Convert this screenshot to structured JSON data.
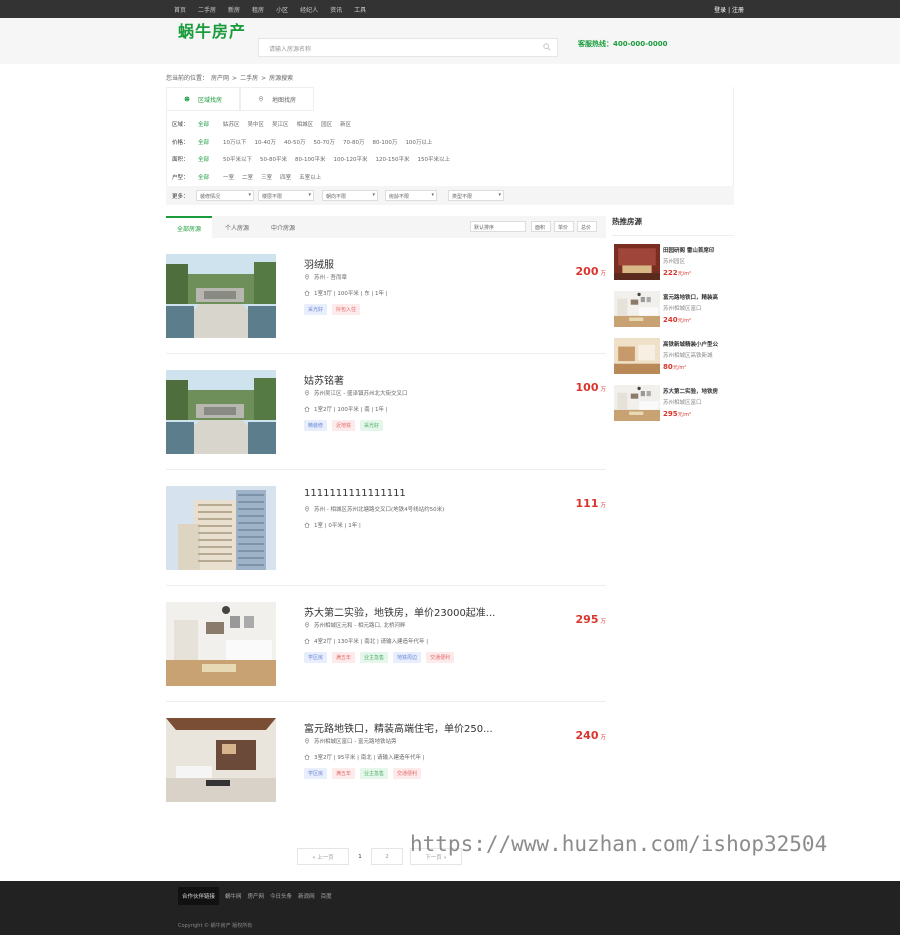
{
  "topbar": {
    "nav": [
      "首页",
      "二手房",
      "新房",
      "租房",
      "小区",
      "经纪人",
      "资讯",
      "工具"
    ],
    "login": "登录 | 注册"
  },
  "header": {
    "logo": "蜗牛房产",
    "search_placeholder": "请输入房源名称",
    "hotline": "客服热线：400-000-0000"
  },
  "breadcrumb": [
    "您当前的位置：",
    "房产网",
    ">",
    "二手房",
    ">",
    "房源搜索"
  ],
  "filter_tabs": [
    "区域找房",
    "地图找房"
  ],
  "filters": [
    {
      "label": "区域：",
      "options": [
        "全部",
        "姑苏区",
        "吴中区",
        "吴江区",
        "相城区",
        "园区",
        "新区"
      ]
    },
    {
      "label": "价格：",
      "options": [
        "全部",
        "10万以下",
        "10-40万",
        "40-50万",
        "50-70万",
        "70-80万",
        "80-100万",
        "100万以上"
      ]
    },
    {
      "label": "面积：",
      "options": [
        "全部",
        "50平米以下",
        "50-80平米",
        "80-100平米",
        "100-120平米",
        "120-150平米",
        "150平米以上"
      ]
    },
    {
      "label": "户型：",
      "options": [
        "全部",
        "一室",
        "二室",
        "三室",
        "四室",
        "五室以上"
      ]
    }
  ],
  "more": {
    "label": "更多：",
    "selects": [
      "装修情况",
      "楼层不限",
      "朝向不限",
      "房龄不限",
      "类型不限"
    ]
  },
  "list_tabs": [
    "全部房源",
    "个人房源",
    "中介房源"
  ],
  "sort": [
    "默认排序",
    "面积",
    "单价",
    "总价"
  ],
  "listings": [
    {
      "title": "羽绒服",
      "address": "苏州 - 吾而章",
      "info": "1室3厅 | 100平米 | 东 | 1年 |",
      "tags": [
        {
          "t": "采光好",
          "c": "blue"
        },
        {
          "t": "拎包入住",
          "c": "red"
        }
      ],
      "price": "200",
      "unit": "万",
      "pic": "garden"
    },
    {
      "title": "姑苏铭著",
      "address": "苏州吴江区 - 盛泽镇苏州北大街交叉口",
      "info": "1室2厅 | 100平米 | 南 | 1年 |",
      "tags": [
        {
          "t": "精装修",
          "c": "blue"
        },
        {
          "t": "近地铁",
          "c": "red"
        },
        {
          "t": "采光好",
          "c": "green"
        }
      ],
      "price": "100",
      "unit": "万",
      "pic": "garden"
    },
    {
      "title": "1111111111111111",
      "address": "苏州 - 相城区苏州北塘路交叉口(地铁4号线站约50米)",
      "info": "1室 | 0平米 | 1年 |",
      "tags": [],
      "price": "111",
      "unit": "万",
      "pic": "tower"
    },
    {
      "title": "苏大第二实验，地铁房，单价23000起准...",
      "address": "苏州相城区元和 - 相元路口, 北桥河畔",
      "info": "4室2厅 | 130平米 | 南北 | 请输入建造年代年 |",
      "tags": [
        {
          "t": "学区房",
          "c": "blue"
        },
        {
          "t": "满五年",
          "c": "red"
        },
        {
          "t": "业主急售",
          "c": "green"
        },
        {
          "t": "地铁周边",
          "c": "blue"
        },
        {
          "t": "交通便利",
          "c": "red"
        }
      ],
      "price": "295",
      "unit": "万",
      "pic": "living"
    },
    {
      "title": "富元路地铁口，精装高端住宅，单价250...",
      "address": "苏州相城区富口 - 富元路地铁站旁",
      "info": "3室2厅 | 95平米 | 南北 | 请输入建造年代年 |",
      "tags": [
        {
          "t": "学区房",
          "c": "blue"
        },
        {
          "t": "满五年",
          "c": "red"
        },
        {
          "t": "业主急售",
          "c": "green"
        },
        {
          "t": "交通便利",
          "c": "red"
        }
      ],
      "price": "240",
      "unit": "万",
      "pic": "lounge"
    }
  ],
  "hot": {
    "title": "热推房源",
    "items": [
      {
        "title": "田园研阁 雷山首席印",
        "addr": "苏州园区",
        "price": "222",
        "unit": "元/m²",
        "pic": "red"
      },
      {
        "title": "富元路地铁口，精装高",
        "addr": "苏州相城区富口",
        "price": "240",
        "unit": "元/m²",
        "pic": "living"
      },
      {
        "title": "高铁新城精装小户型公",
        "addr": "苏州相城区高铁新城",
        "price": "80",
        "unit": "元/m²",
        "pic": "warm"
      },
      {
        "title": "苏大第二实验，地铁房",
        "addr": "苏州相城区富口",
        "price": "295",
        "unit": "元/m²",
        "pic": "living"
      }
    ]
  },
  "pager": {
    "prev": "« 上一页",
    "current": "1",
    "page2": "2",
    "next": "下一页 »"
  },
  "watermark": "https://www.huzhan.com/ishop32504",
  "footer": {
    "links_title": "合作伙伴链接",
    "links": [
      "蜗牛网",
      "房产网",
      "今日头条",
      "新浪网",
      "百度"
    ],
    "copyright": "Copyright © 蜗牛房产 版权所有"
  },
  "colors": {
    "accent": "#1a9c3c",
    "price": "#d9352c",
    "topbar": "#333333",
    "footer": "#222222"
  }
}
